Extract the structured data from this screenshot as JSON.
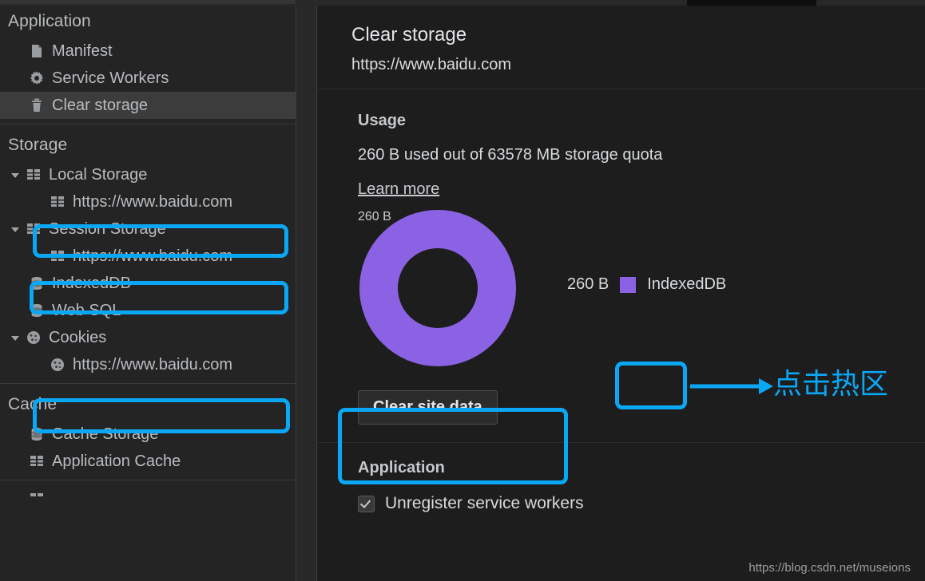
{
  "sidebar": {
    "sections": [
      {
        "title": "Application",
        "items": [
          {
            "label": "Manifest",
            "icon": "document-icon",
            "indent": 1,
            "twisty": "none",
            "selected": false
          },
          {
            "label": "Service Workers",
            "icon": "gear-icon",
            "indent": 1,
            "twisty": "none",
            "selected": false
          },
          {
            "label": "Clear storage",
            "icon": "trash-icon",
            "indent": 1,
            "twisty": "none",
            "selected": true
          }
        ]
      },
      {
        "title": "Storage",
        "items": [
          {
            "label": "Local Storage",
            "icon": "table-icon",
            "indent": 1,
            "twisty": "open",
            "selected": false
          },
          {
            "label": "https://www.baidu.com",
            "icon": "table-icon",
            "indent": 2,
            "twisty": "none",
            "selected": false,
            "highlight": true
          },
          {
            "label": "Session Storage",
            "icon": "table-icon",
            "indent": 1,
            "twisty": "open",
            "selected": false
          },
          {
            "label": "https://www.baidu.com",
            "icon": "table-icon",
            "indent": 2,
            "twisty": "none",
            "selected": false,
            "highlight": true
          },
          {
            "label": "IndexedDB",
            "icon": "database-icon",
            "indent": 1,
            "twisty": "none",
            "selected": false
          },
          {
            "label": "Web SQL",
            "icon": "database-icon",
            "indent": 1,
            "twisty": "none",
            "selected": false
          },
          {
            "label": "Cookies",
            "icon": "cookie-icon",
            "indent": 1,
            "twisty": "open",
            "selected": false
          },
          {
            "label": "https://www.baidu.com",
            "icon": "cookie-icon",
            "indent": 2,
            "twisty": "none",
            "selected": false,
            "highlight": true
          }
        ]
      },
      {
        "title": "Cache",
        "items": [
          {
            "label": "Cache Storage",
            "icon": "database-icon",
            "indent": 1,
            "twisty": "none",
            "selected": false
          },
          {
            "label": "Application Cache",
            "icon": "table-icon",
            "indent": 1,
            "twisty": "none",
            "selected": false
          }
        ]
      }
    ]
  },
  "panel": {
    "title": "Clear storage",
    "origin": "https://www.baidu.com",
    "usage": {
      "heading": "Usage",
      "text": "260 B used out of 63578 MB storage quota",
      "learn_more": "Learn more"
    },
    "clear_button": "Clear site data",
    "application": {
      "heading": "Application",
      "checkbox_label": "Unregister service workers",
      "checkbox_checked": true
    }
  },
  "chart_data": {
    "type": "pie",
    "title": "Usage",
    "center_label": "260 B",
    "total": "260 B",
    "unit": "B",
    "legend_position": "right",
    "categories": [
      "IndexedDB"
    ],
    "values": [
      260
    ],
    "value_labels": [
      "260 B"
    ],
    "colors": [
      "#8c62e4"
    ],
    "series": [
      {
        "name": "IndexedDB",
        "value": 260,
        "value_label": "260 B",
        "color": "#8c62e4",
        "percent": 100
      }
    ]
  },
  "annotations": {
    "accent_color": "#0aa7f5",
    "hotspot_text": "点击热区"
  },
  "watermark": "https://blog.csdn.net/museions"
}
